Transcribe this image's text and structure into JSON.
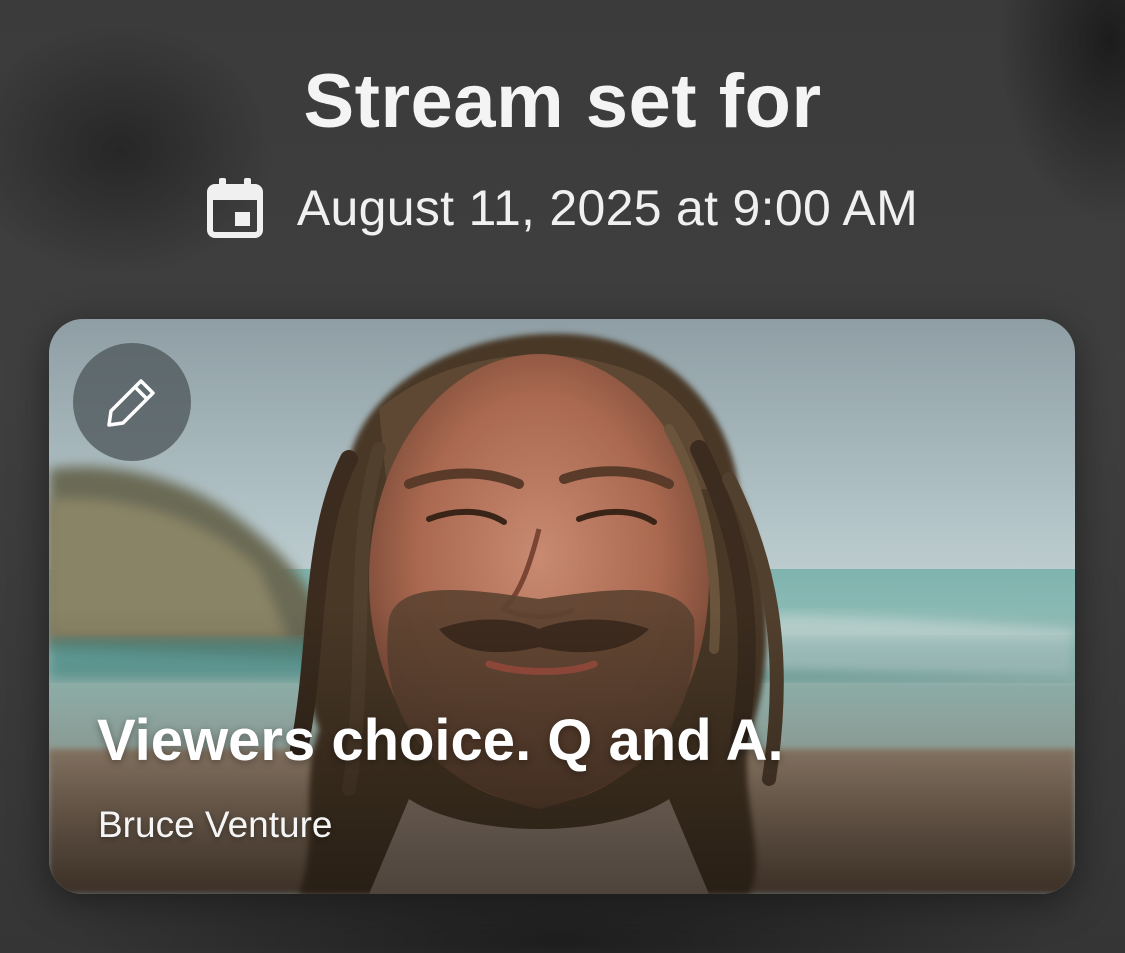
{
  "header": {
    "title": "Stream set for",
    "calendar_icon": "calendar-icon",
    "scheduled_date": "August 11, 2025 at 9:00 AM"
  },
  "card": {
    "edit_icon": "pencil-icon",
    "title": "Viewers choice. Q and A.",
    "author": "Bruce Venture",
    "image": "photo-of-bearded-man-with-dreadlocks-on-beach"
  },
  "colors": {
    "background": "#3b3b3b",
    "text": "#f4f4f4",
    "edit_button_bg": "#50585c"
  }
}
